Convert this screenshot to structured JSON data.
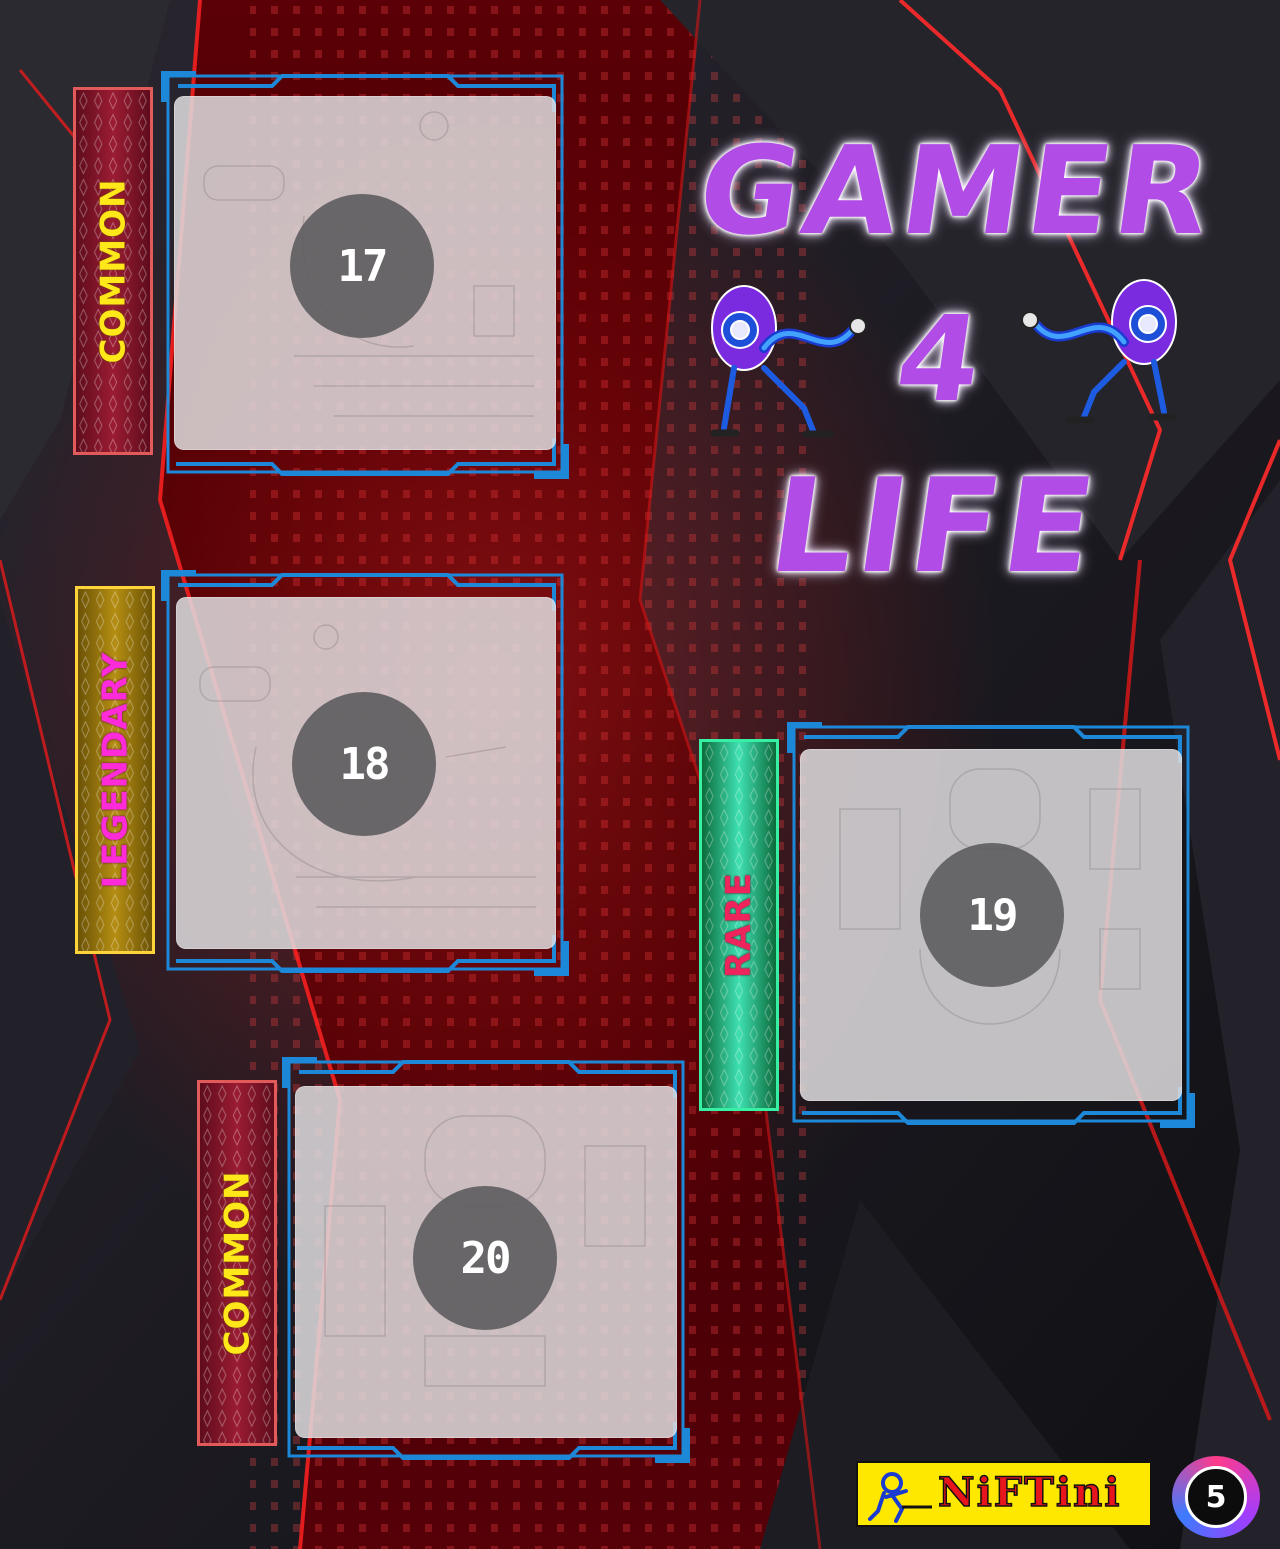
{
  "title": {
    "line1": "GAMER",
    "line2": "4",
    "line3": "LIFE"
  },
  "slots": [
    {
      "number": "17",
      "rarity": "COMMON"
    },
    {
      "number": "18",
      "rarity": "LEGENDARY"
    },
    {
      "number": "19",
      "rarity": "RARE"
    },
    {
      "number": "20",
      "rarity": "COMMON"
    }
  ],
  "footer": {
    "brand": "NiFTini",
    "page_number": "5"
  },
  "colors": {
    "frame_blue": "#1e88d8",
    "title_purple": "#b14de6",
    "common_banner": "#9b1c33",
    "common_text": "#ffe81a",
    "legendary_banner": "#b58e12",
    "legendary_text": "#ff2bd8",
    "rare_banner": "#3fe0b2",
    "rare_text": "#f0245c",
    "brand_yellow": "#ffe800",
    "brand_red": "#e7151c"
  },
  "icons": {
    "mascot_left": "blue-ghost-mascot-icon",
    "mascot_right": "blue-ghost-mascot-icon",
    "brand_logo": "niftini-runner-icon"
  }
}
